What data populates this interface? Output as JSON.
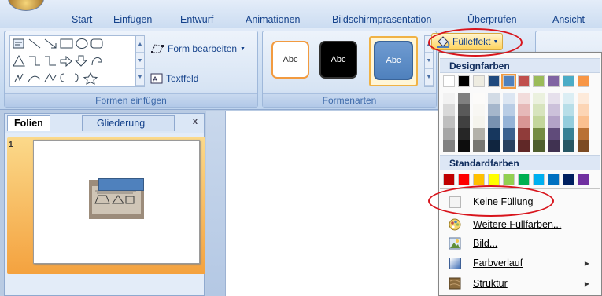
{
  "ribbon": {
    "tabs": [
      "Start",
      "Einfügen",
      "Entwurf",
      "Animationen",
      "Bildschirmpräsentation",
      "Überprüfen",
      "Ansicht"
    ],
    "groups": {
      "shapes": {
        "label": "Formen einfügen",
        "edit_shape": "Form bearbeiten",
        "textbox": "Textfeld"
      },
      "styles": {
        "label": "Formenarten",
        "sample_text": "Abc",
        "fill_button": "Fülleffekt"
      }
    }
  },
  "left_pane": {
    "tabs": [
      "Folien",
      "Gliederung"
    ],
    "close": "x",
    "slide_number": "1"
  },
  "fill_menu": {
    "design_colors_header": "Designfarben",
    "standard_colors_header": "Standardfarben",
    "no_fill": "Keine Füllung",
    "more_colors": "Weitere Füllfarben...",
    "picture": "Bild...",
    "gradient": "Farbverlauf",
    "texture": "Struktur",
    "design_colors": [
      "#ffffff",
      "#000000",
      "#eeece1",
      "#1f497d",
      "#4f81bd",
      "#c0504d",
      "#9bbb59",
      "#8064a2",
      "#4bacc6",
      "#f79646"
    ],
    "standard_colors": [
      "#c00000",
      "#ff0000",
      "#ffc000",
      "#ffff00",
      "#92d050",
      "#00b050",
      "#00b0f0",
      "#0070c0",
      "#002060",
      "#7030a0"
    ]
  },
  "colors": {
    "callout": "#d8141c",
    "ribbon_text": "#15428b",
    "selected_style": "#4f81bd"
  }
}
